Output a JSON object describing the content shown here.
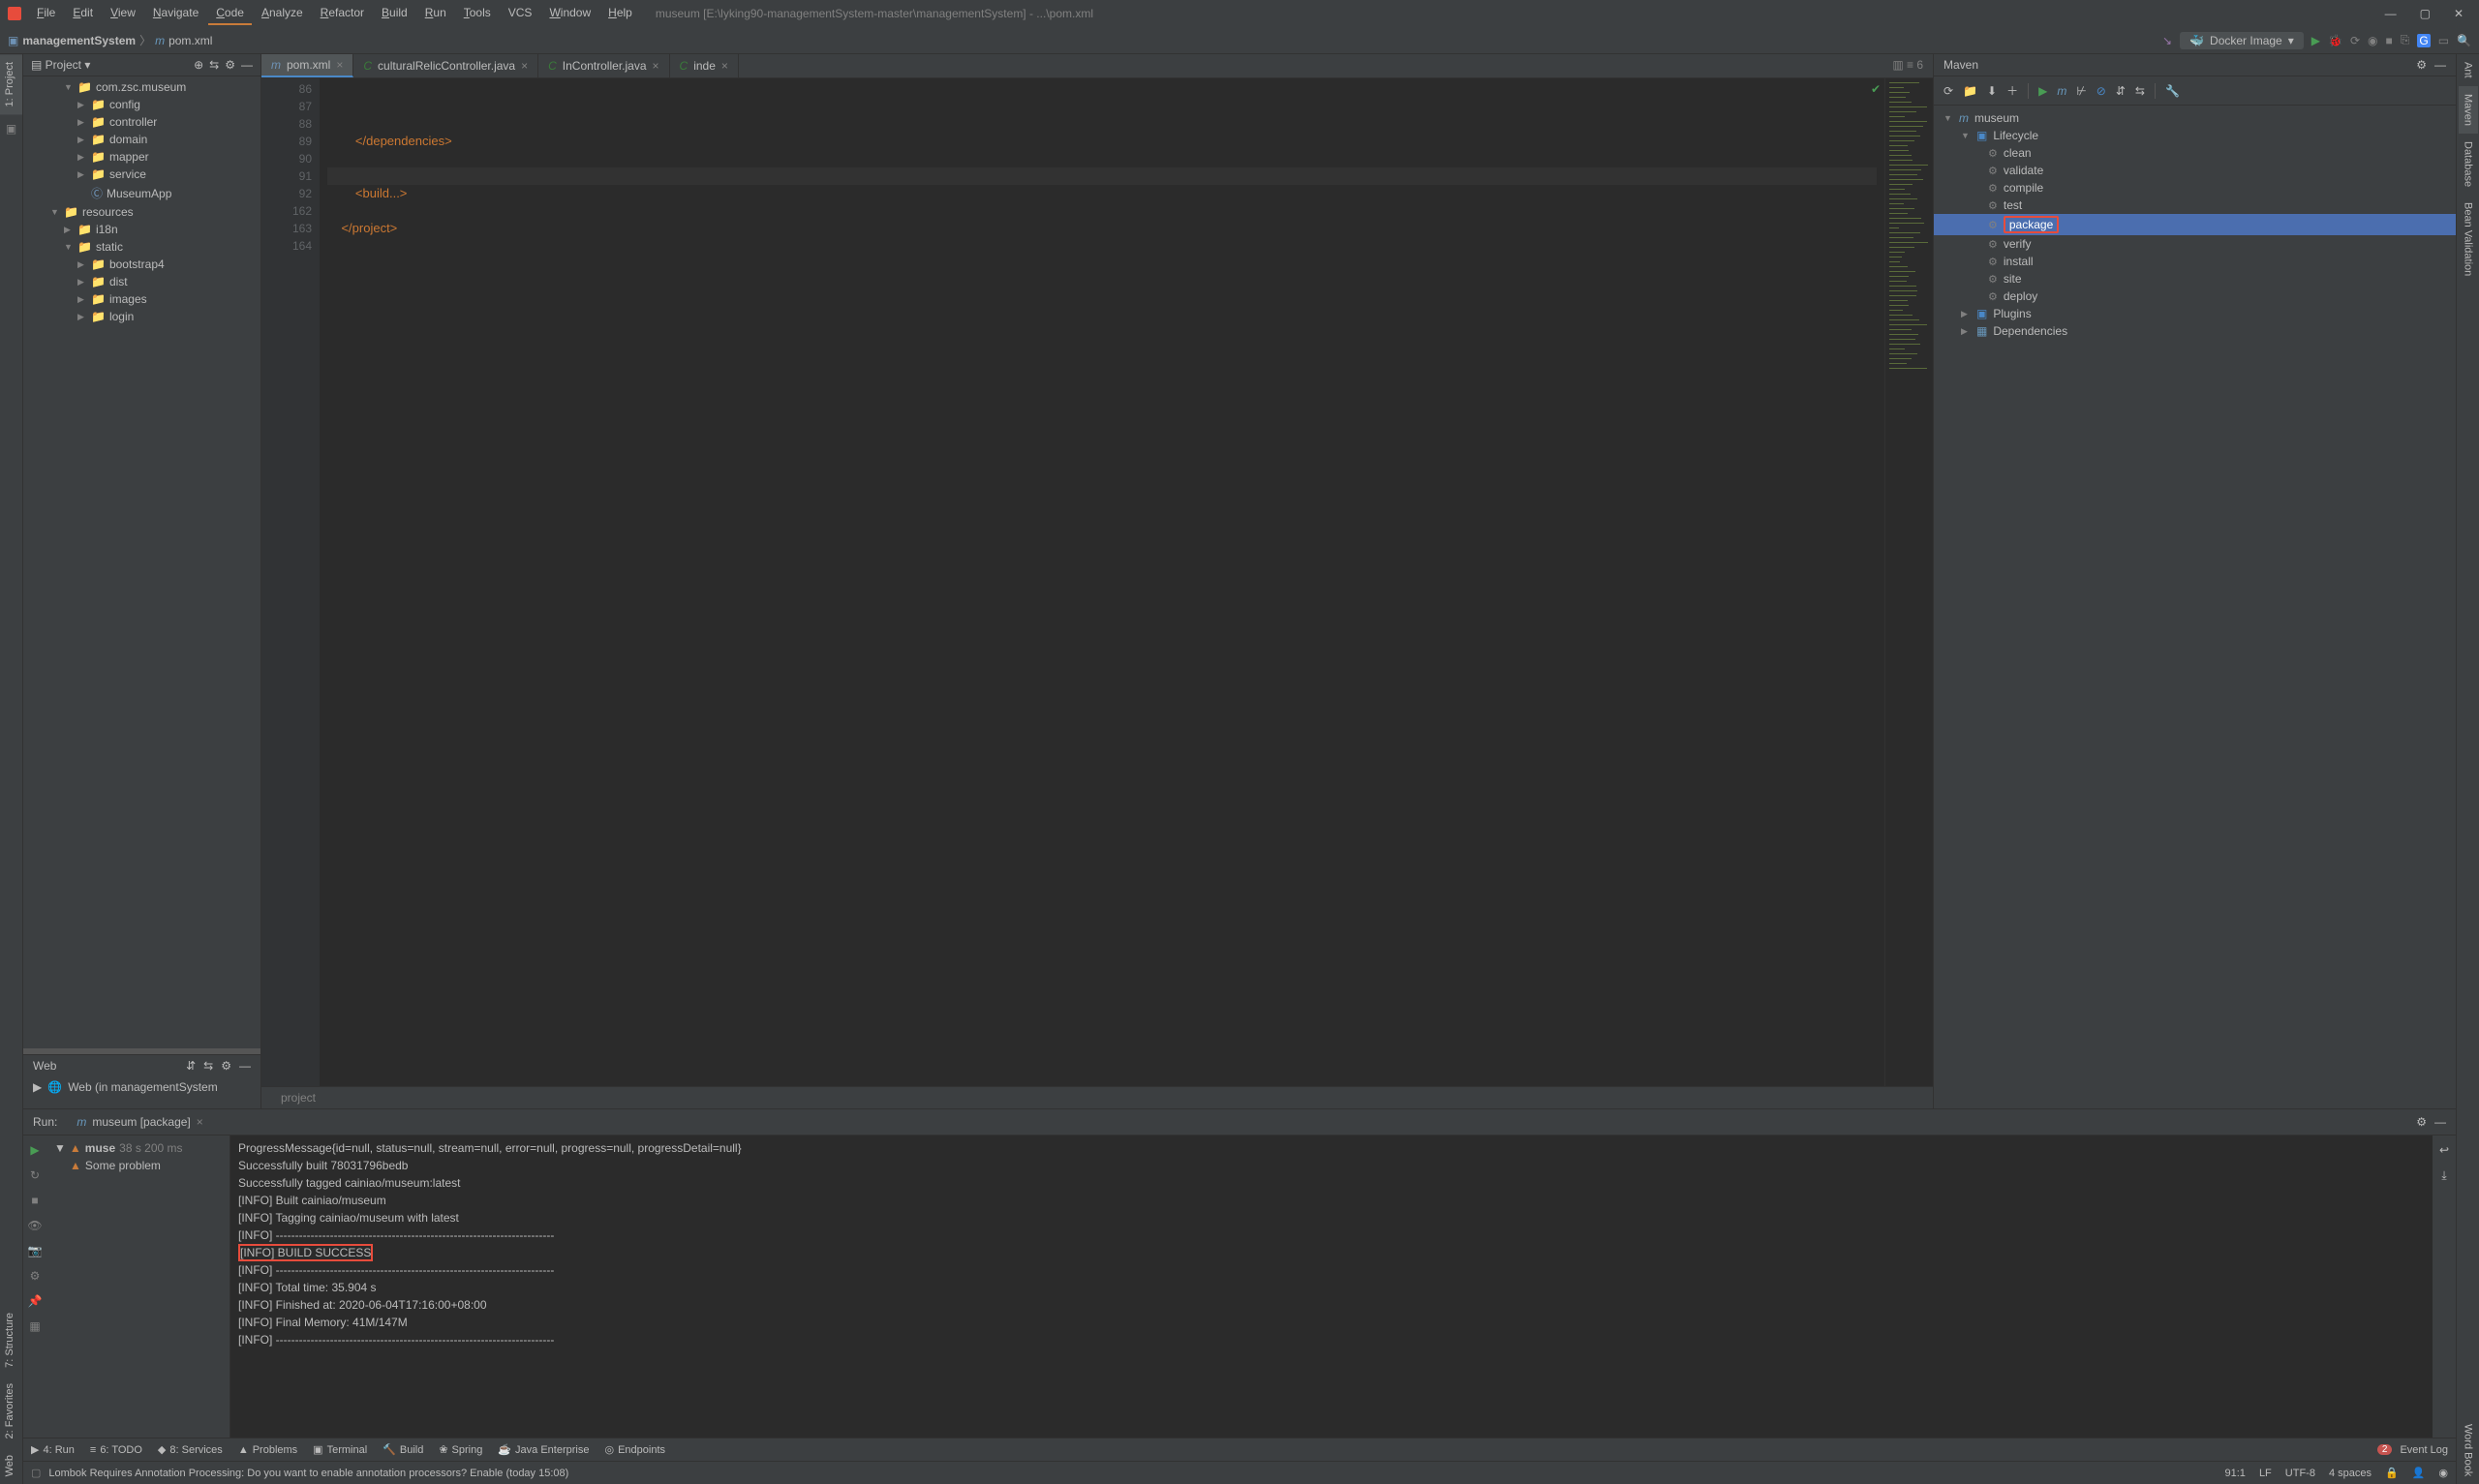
{
  "menu": {
    "file": "File",
    "edit": "Edit",
    "view": "View",
    "navigate": "Navigate",
    "code": "Code",
    "analyze": "Analyze",
    "refactor": "Refactor",
    "build": "Build",
    "run": "Run",
    "tools": "Tools",
    "vcs": "VCS",
    "window": "Window",
    "help": "Help"
  },
  "title_path": "museum [E:\\lyking90-managementSystem-master\\managementSystem] - ...\\pom.xml",
  "breadcrumb": {
    "root": "managementSystem",
    "file": "pom.xml"
  },
  "docker": "Docker Image",
  "project": {
    "label": "Project",
    "items": [
      {
        "indent": 3,
        "arrow": "▼",
        "icon": "📁",
        "label": "com.zsc.museum",
        "type": "pkg"
      },
      {
        "indent": 4,
        "arrow": "▶",
        "icon": "📁",
        "label": "config"
      },
      {
        "indent": 4,
        "arrow": "▶",
        "icon": "📁",
        "label": "controller"
      },
      {
        "indent": 4,
        "arrow": "▶",
        "icon": "📁",
        "label": "domain"
      },
      {
        "indent": 4,
        "arrow": "▶",
        "icon": "📁",
        "label": "mapper"
      },
      {
        "indent": 4,
        "arrow": "▶",
        "icon": "📁",
        "label": "service"
      },
      {
        "indent": 4,
        "arrow": "",
        "icon": "Ⓒ",
        "label": "MuseumApp",
        "type": "class"
      },
      {
        "indent": 2,
        "arrow": "▼",
        "icon": "📁",
        "label": "resources",
        "type": "res"
      },
      {
        "indent": 3,
        "arrow": "▶",
        "icon": "📁",
        "label": "i18n"
      },
      {
        "indent": 3,
        "arrow": "▼",
        "icon": "📁",
        "label": "static"
      },
      {
        "indent": 4,
        "arrow": "▶",
        "icon": "📁",
        "label": "bootstrap4"
      },
      {
        "indent": 4,
        "arrow": "▶",
        "icon": "📁",
        "label": "dist"
      },
      {
        "indent": 4,
        "arrow": "▶",
        "icon": "📁",
        "label": "images"
      },
      {
        "indent": 4,
        "arrow": "▶",
        "icon": "📁",
        "label": "login"
      }
    ]
  },
  "tabs": [
    {
      "icon": "m",
      "label": "pom.xml",
      "active": true,
      "color": "#6e92b5"
    },
    {
      "icon": "C",
      "label": "culturalRelicController.java",
      "color": "#3a7a3a"
    },
    {
      "icon": "C",
      "label": "InController.java",
      "color": "#3a7a3a"
    },
    {
      "icon": "C",
      "label": "inde",
      "color": "#3a7a3a"
    }
  ],
  "editor": {
    "lines": [
      {
        "num": 86,
        "text": ""
      },
      {
        "num": 87,
        "text": ""
      },
      {
        "num": 88,
        "text": ""
      },
      {
        "num": 89,
        "text": "        </dependencies>",
        "tagged": true
      },
      {
        "num": 90,
        "text": ""
      },
      {
        "num": 91,
        "text": "",
        "caret": true
      },
      {
        "num": 92,
        "text": "        <build...>",
        "tagged": true
      },
      {
        "num": 162,
        "text": ""
      },
      {
        "num": 163,
        "text": "    </project>",
        "tagged": true
      },
      {
        "num": 164,
        "text": ""
      }
    ],
    "crumb": "project"
  },
  "maven": {
    "title": "Maven",
    "root": "museum",
    "lifecycle": "Lifecycle",
    "goals": [
      "clean",
      "validate",
      "compile",
      "test",
      "package",
      "verify",
      "install",
      "site",
      "deploy"
    ],
    "selected": "package",
    "plugins": "Plugins",
    "dependencies": "Dependencies"
  },
  "web": {
    "title": "Web",
    "row": "Web (in managementSystem"
  },
  "run": {
    "label": "Run:",
    "tab": "museum [package]",
    "tree": {
      "main": "muse",
      "time": "38 s 200 ms",
      "sub": "Some problem"
    },
    "console": "ProgressMessage{id=null, status=null, stream=null, error=null, progress=null, progressDetail=null}\nSuccessfully built 78031796bedb\nSuccessfully tagged cainiao/museum:latest\n[INFO] Built cainiao/museum\n[INFO] Tagging cainiao/museum with latest\n[INFO] ------------------------------------------------------------------------\n[INFO] BUILD SUCCESS\n[INFO] ------------------------------------------------------------------------\n[INFO] Total time: 35.904 s\n[INFO] Finished at: 2020-06-04T17:16:00+08:00\n[INFO] Final Memory: 41M/147M\n[INFO] ------------------------------------------------------------------------"
  },
  "bottom_tabs": {
    "run": "4: Run",
    "todo": "6: TODO",
    "services": "8: Services",
    "problems": "Problems",
    "terminal": "Terminal",
    "build": "Build",
    "spring": "Spring",
    "java_ee": "Java Enterprise",
    "endpoints": "Endpoints",
    "eventlog": "Event Log",
    "eventlog_count": "2"
  },
  "statusbar": {
    "msg": "Lombok Requires Annotation Processing: Do you want to enable annotation processors? Enable (today 15:08)",
    "pos": "91:1",
    "lf": "LF",
    "enc": "UTF-8",
    "indent": "4 spaces"
  },
  "side_tabs": {
    "project": "1: Project",
    "structure": "7: Structure",
    "favorites": "2: Favorites",
    "web": "Web",
    "ant": "Ant",
    "maven": "Maven",
    "database": "Database",
    "bean": "Bean Validation",
    "wordbook": "Word Book"
  }
}
